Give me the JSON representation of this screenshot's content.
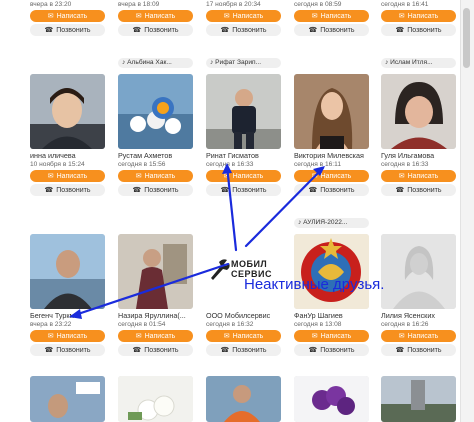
{
  "buttons": {
    "write": "Написать",
    "call": "Позвонить"
  },
  "icons": {
    "write": "mail-icon",
    "call": "phone-icon"
  },
  "accent": "#f7901e",
  "arrow_color": "#1a2bdc",
  "row0": [
    {
      "seen": "вчера в 23:20"
    },
    {
      "seen": "вчера в 18:09"
    },
    {
      "seen": "17 ноября в 20:34"
    },
    {
      "seen": "сегодня в 08:59"
    },
    {
      "seen": "сегодня в 16:41"
    }
  ],
  "row1": [
    {
      "group": "",
      "name": "инна иличева",
      "seen": "10 ноября в 15:24"
    },
    {
      "group": "Альбина Хак...",
      "name": "Рустам Ахметов",
      "seen": "сегодня в 15:56"
    },
    {
      "group": "Рифат Зарип...",
      "name": "Ринат Гисматов",
      "seen": "сегодня в 16:33"
    },
    {
      "group": "",
      "name": "Виктория Милевская",
      "seen": "сегодня в 16:11"
    },
    {
      "group": "Ислам Итля...",
      "name": "Гуля Ильгамова",
      "seen": "сегодня в 16:33"
    }
  ],
  "row2": [
    {
      "group": "",
      "name": "Бегенч Туркм...",
      "seen": "вчера в 23:22"
    },
    {
      "group": "",
      "name": "Назира Яруллина(...",
      "seen": "сегодня в 01:54"
    },
    {
      "group": "",
      "name": "ООО Мобилсервис",
      "seen": "сегодня в 16:32"
    },
    {
      "group": "АУЛИЯ-2022...",
      "name": "ФанУр Шагиев",
      "seen": "сегодня в 13:08"
    },
    {
      "group": "",
      "name": "Лилия Ясенских",
      "seen": "сегодня в 16:26"
    }
  ],
  "annotation": "Неактивные друзья.",
  "logo": {
    "line1": "МОБИЛ",
    "line2": "СЕРВИС"
  }
}
